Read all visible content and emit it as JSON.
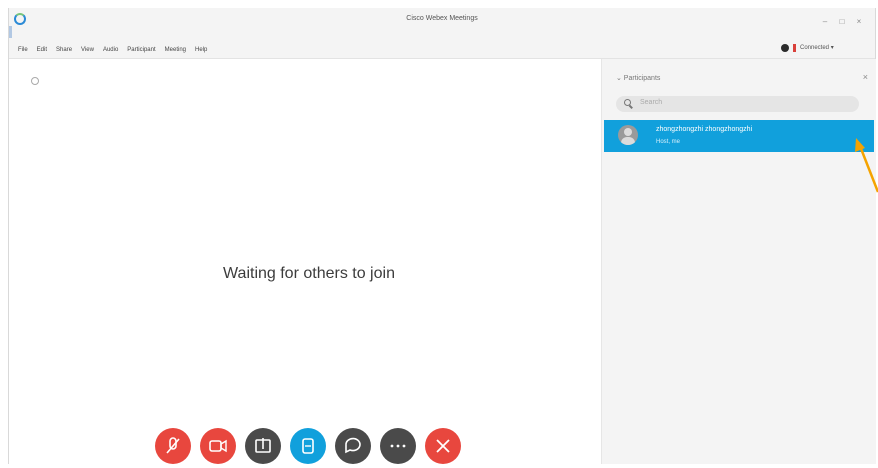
{
  "window": {
    "title": "Cisco Webex Meetings"
  },
  "menubar": {
    "items": [
      "File",
      "Edit",
      "Share",
      "View",
      "Audio",
      "Participant",
      "Meeting",
      "Help"
    ],
    "connection_label": "Connected ▾"
  },
  "main": {
    "waiting_text": "Waiting for others to join"
  },
  "panel": {
    "header": "⌄ Participants",
    "search_placeholder": "Search",
    "participants": [
      {
        "name": "zhongzhongzhi zhongzhongzhi",
        "role": "Host, me"
      }
    ]
  },
  "controls": [
    {
      "name": "mute",
      "color": "#e8473e"
    },
    {
      "name": "video",
      "color": "#e8473e"
    },
    {
      "name": "share",
      "color": "#4a4a4a"
    },
    {
      "name": "record",
      "color": "#11a0dc"
    },
    {
      "name": "chat",
      "color": "#4a4a4a"
    },
    {
      "name": "more",
      "color": "#4a4a4a"
    },
    {
      "name": "leave",
      "color": "#e8473e"
    }
  ],
  "annotation_color": "#f5a300"
}
